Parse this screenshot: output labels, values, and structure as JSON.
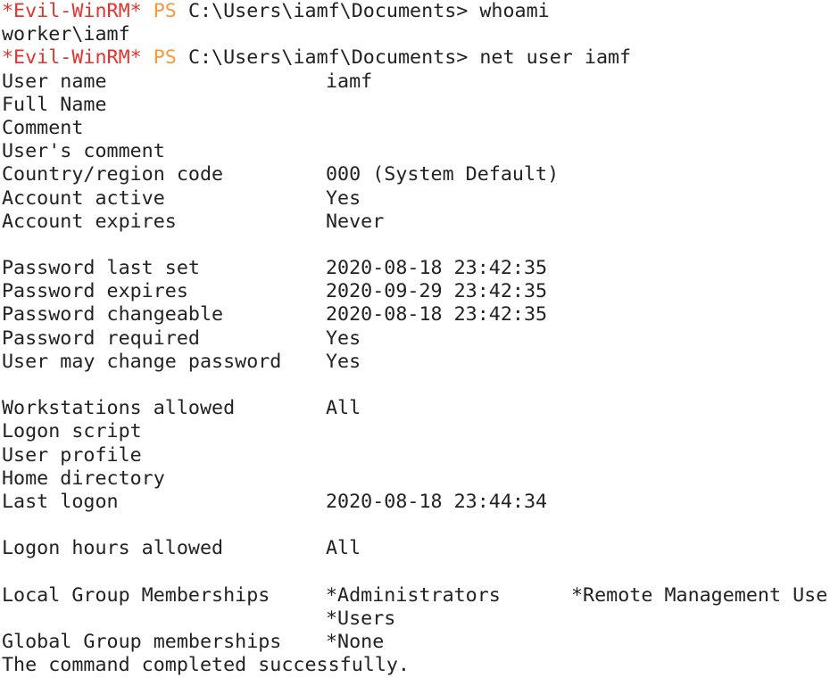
{
  "prompt": {
    "evil": "*Evil-WinRM*",
    "ps": "PS",
    "path": "C:\\Users\\iamf\\Documents>",
    "accent_evil": "#e3342f",
    "accent_ps": "#f6993f"
  },
  "commands": {
    "whoami": "whoami",
    "whoami_output": "worker\\iamf",
    "net_user": "net user iamf"
  },
  "fields": {
    "user_name": {
      "label": "User name",
      "value": "iamf"
    },
    "full_name": {
      "label": "Full Name",
      "value": ""
    },
    "comment": {
      "label": "Comment",
      "value": ""
    },
    "users_comment": {
      "label": "User's comment",
      "value": ""
    },
    "country_code": {
      "label": "Country/region code",
      "value": "000 (System Default)"
    },
    "account_active": {
      "label": "Account active",
      "value": "Yes"
    },
    "account_expires": {
      "label": "Account expires",
      "value": "Never"
    },
    "password_last_set": {
      "label": "Password last set",
      "value": "2020-08-18 23:42:35"
    },
    "password_expires": {
      "label": "Password expires",
      "value": "2020-09-29 23:42:35"
    },
    "password_changeable": {
      "label": "Password changeable",
      "value": "2020-08-18 23:42:35"
    },
    "password_required": {
      "label": "Password required",
      "value": "Yes"
    },
    "user_may_change_password": {
      "label": "User may change password",
      "value": "Yes"
    },
    "workstations_allowed": {
      "label": "Workstations allowed",
      "value": "All"
    },
    "logon_script": {
      "label": "Logon script",
      "value": ""
    },
    "user_profile": {
      "label": "User profile",
      "value": ""
    },
    "home_directory": {
      "label": "Home directory",
      "value": ""
    },
    "last_logon": {
      "label": "Last logon",
      "value": "2020-08-18 23:44:34"
    },
    "logon_hours_allowed": {
      "label": "Logon hours allowed",
      "value": "All"
    },
    "local_group_memberships": {
      "label": "Local Group Memberships",
      "value": "*Administrators",
      "value2": "*Remote Management Use",
      "value3": "*Users"
    },
    "global_group_memberships": {
      "label": "Global Group memberships",
      "value": "*None"
    }
  },
  "completion": "The command completed successfully."
}
